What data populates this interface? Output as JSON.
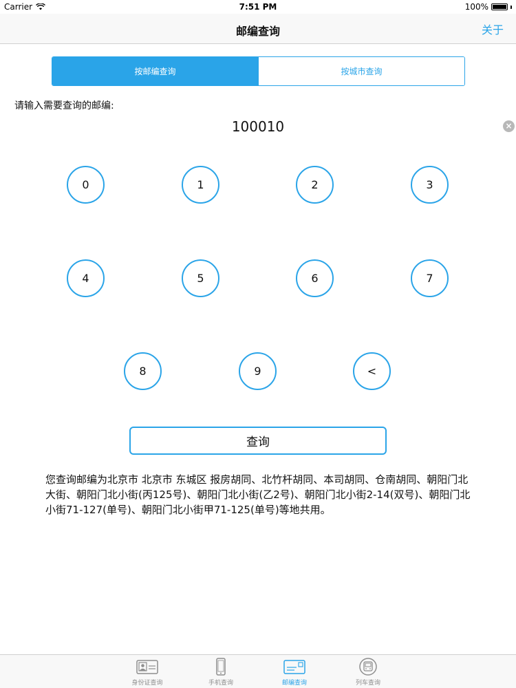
{
  "status_bar": {
    "carrier": "Carrier",
    "time": "7:51 PM",
    "battery": "100%",
    "battery_level": 1.0
  },
  "nav": {
    "title": "邮编查询",
    "right_button": "关于"
  },
  "segments": [
    {
      "label": "按邮编查询",
      "selected": true
    },
    {
      "label": "按城市查询",
      "selected": false
    }
  ],
  "prompt": "请输入需要查询的邮编:",
  "input": {
    "value": "100010",
    "clear_icon": "clear-icon"
  },
  "keypad": {
    "keys": [
      "0",
      "1",
      "2",
      "3",
      "4",
      "5",
      "6",
      "7",
      "8",
      "9",
      "<"
    ]
  },
  "query_button": "查询",
  "result_text": "您查询邮编为北京市 北京市 东城区 报房胡同、北竹杆胡同、本司胡同、仓南胡同、朝阳门北大街、朝阳门北小街(丙125号)、朝阳门北小街(乙2号)、朝阳门北小街2-14(双号)、朝阳门北小街71-127(单号)、朝阳门北小街甲71-125(单号)等地共用。",
  "tabs": [
    {
      "label": "身份证查询",
      "icon": "id-card-icon",
      "selected": false
    },
    {
      "label": "手机查询",
      "icon": "phone-icon",
      "selected": false
    },
    {
      "label": "邮编查询",
      "icon": "postcode-icon",
      "selected": true
    },
    {
      "label": "列车查询",
      "icon": "train-icon",
      "selected": false
    }
  ],
  "colors": {
    "accent": "#2aa4e8",
    "inactive_tab": "#8e8e8e"
  }
}
